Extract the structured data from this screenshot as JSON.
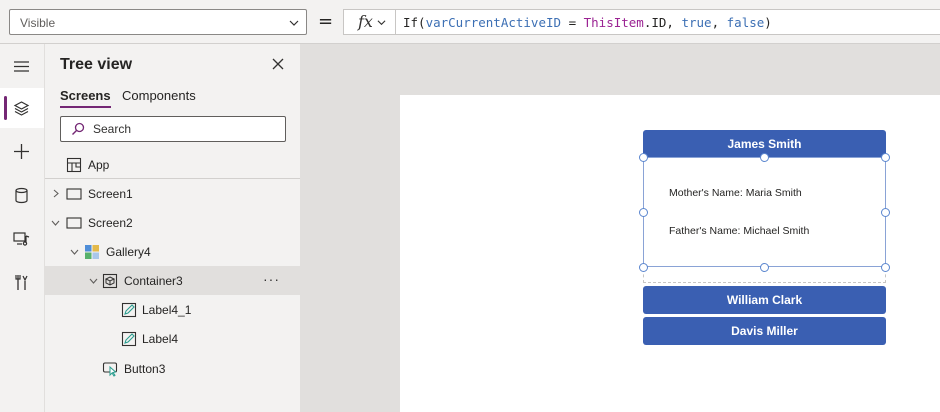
{
  "formula_bar": {
    "property": "Visible",
    "equals": "=",
    "fx_label": "fx",
    "formula": {
      "fn_open": "If(",
      "var": "varCurrentActiveID",
      "op": " = ",
      "kw": "ThisItem",
      "member": ".ID, ",
      "true_lit": "true",
      "comma": ", ",
      "false_lit": "false",
      "close": ")"
    }
  },
  "rail": {
    "items": [
      {
        "icon": "hamburger-icon"
      },
      {
        "icon": "layers-icon",
        "active": true
      },
      {
        "icon": "plus-icon"
      },
      {
        "icon": "database-icon"
      },
      {
        "icon": "media-icon"
      },
      {
        "icon": "tools-icon"
      }
    ]
  },
  "tree_view": {
    "title": "Tree view",
    "tabs": [
      "Screens",
      "Components"
    ],
    "search_placeholder": "Search",
    "nodes": [
      {
        "label": "App"
      },
      {
        "label": "Screen1"
      },
      {
        "label": "Screen2"
      },
      {
        "label": "Gallery4"
      },
      {
        "label": "Container3",
        "selected": true,
        "more": "···"
      },
      {
        "label": "Label4_1"
      },
      {
        "label": "Label4"
      },
      {
        "label": "Button3"
      }
    ]
  },
  "canvas": {
    "gallery": {
      "header": "James Smith",
      "mother": "Mother's Name: Maria Smith",
      "father": "Father's Name: Michael Smith",
      "items": [
        "William Clark",
        "Davis Miller"
      ]
    }
  },
  "colors": {
    "accent": "#742774",
    "button": "#3a5fb2",
    "selection": "#5b86cf"
  }
}
